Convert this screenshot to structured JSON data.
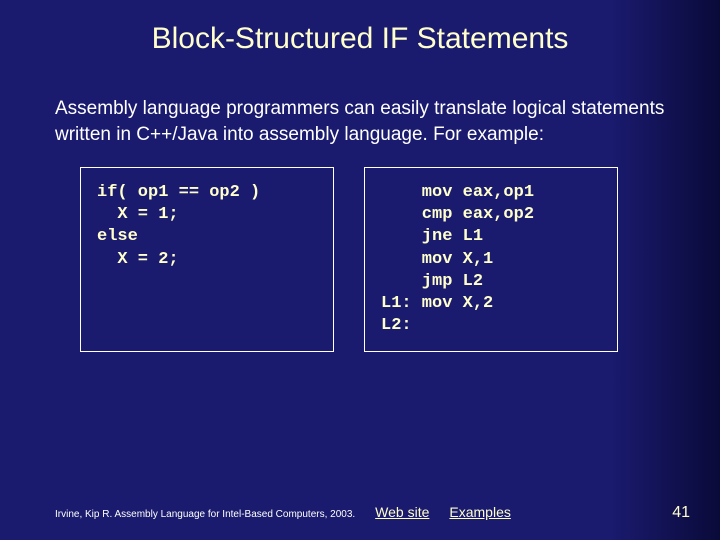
{
  "title": "Block-Structured IF Statements",
  "body": "Assembly language programmers can easily translate logical statements written in C++/Java into assembly language. For example:",
  "code": {
    "left": "if( op1 == op2 )\n  X = 1;\nelse\n  X = 2;",
    "right": "    mov eax,op1\n    cmp eax,op2\n    jne L1\n    mov X,1\n    jmp L2\nL1: mov X,2\nL2:"
  },
  "footer": {
    "citation": "Irvine, Kip R. Assembly Language for Intel-Based Computers, 2003.",
    "link_website": "Web site",
    "link_examples": "Examples",
    "page": "41"
  }
}
